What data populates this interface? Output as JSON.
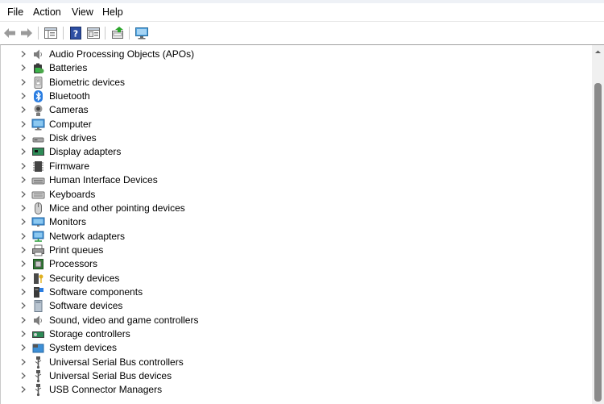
{
  "menu": [
    "File",
    "Action",
    "View",
    "Help"
  ],
  "menu_accel": [
    0,
    0,
    0,
    0
  ],
  "toolbar": {
    "back_icon": "back-arrow-icon",
    "forward_icon": "forward-arrow-icon",
    "show_hide_console_icon": "console-tree-icon",
    "help_icon": "help-icon",
    "properties_icon": "properties-icon",
    "update_driver_icon": "update-driver-icon",
    "scan_hardware_icon": "scan-hardware-icon"
  },
  "tree": {
    "items": [
      {
        "label": "Audio Processing Objects (APOs)",
        "icon": "speaker-icon"
      },
      {
        "label": "Batteries",
        "icon": "battery-icon"
      },
      {
        "label": "Biometric devices",
        "icon": "biometric-icon"
      },
      {
        "label": "Bluetooth",
        "icon": "bluetooth-icon"
      },
      {
        "label": "Cameras",
        "icon": "camera-icon"
      },
      {
        "label": "Computer",
        "icon": "computer-icon"
      },
      {
        "label": "Disk drives",
        "icon": "disk-drive-icon"
      },
      {
        "label": "Display adapters",
        "icon": "display-adapter-icon"
      },
      {
        "label": "Firmware",
        "icon": "firmware-icon"
      },
      {
        "label": "Human Interface Devices",
        "icon": "hid-icon"
      },
      {
        "label": "Keyboards",
        "icon": "keyboard-icon"
      },
      {
        "label": "Mice and other pointing devices",
        "icon": "mouse-icon"
      },
      {
        "label": "Monitors",
        "icon": "monitor-icon"
      },
      {
        "label": "Network adapters",
        "icon": "network-adapter-icon"
      },
      {
        "label": "Print queues",
        "icon": "printer-icon"
      },
      {
        "label": "Processors",
        "icon": "processor-icon"
      },
      {
        "label": "Security devices",
        "icon": "security-key-icon"
      },
      {
        "label": "Software components",
        "icon": "software-component-icon"
      },
      {
        "label": "Software devices",
        "icon": "software-device-icon"
      },
      {
        "label": "Sound, video and game controllers",
        "icon": "speaker-icon"
      },
      {
        "label": "Storage controllers",
        "icon": "storage-controller-icon"
      },
      {
        "label": "System devices",
        "icon": "system-devices-icon"
      },
      {
        "label": "Universal Serial Bus controllers",
        "icon": "usb-icon"
      },
      {
        "label": "Universal Serial Bus devices",
        "icon": "usb-icon"
      },
      {
        "label": "USB Connector Managers",
        "icon": "usb-icon"
      }
    ]
  }
}
